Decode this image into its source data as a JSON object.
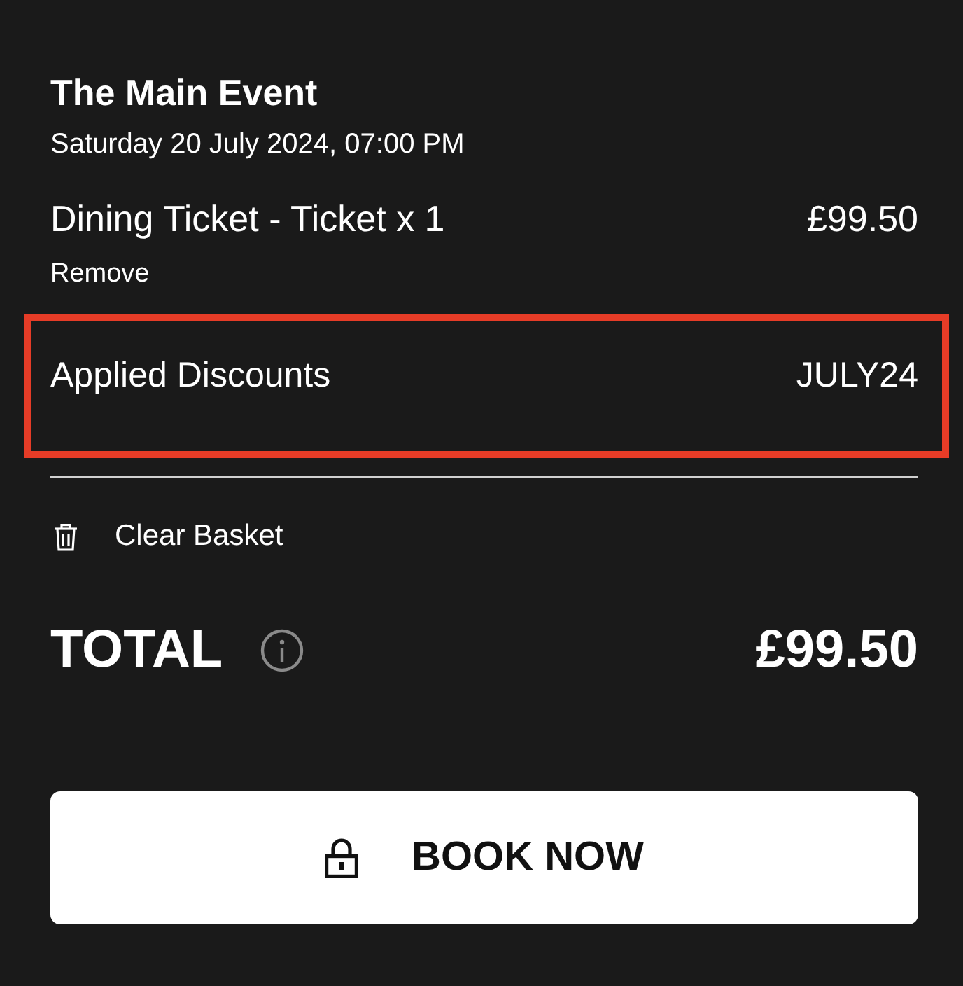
{
  "event": {
    "title": "The Main Event",
    "date": "Saturday 20 July 2024, 07:00 PM"
  },
  "items": [
    {
      "name": "Dining Ticket - Ticket x 1",
      "price": "£99.50",
      "remove_label": "Remove"
    }
  ],
  "discounts": {
    "label": "Applied Discounts",
    "code": "JULY24",
    "highlighted": true
  },
  "clear_basket": {
    "label": "Clear Basket"
  },
  "total": {
    "label": "TOTAL",
    "amount": "£99.50"
  },
  "book_button": {
    "label": "BOOK NOW"
  }
}
